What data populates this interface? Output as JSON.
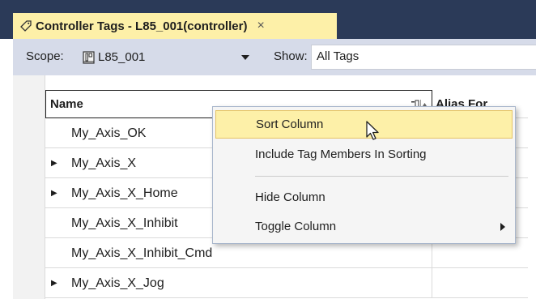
{
  "tab": {
    "title": "Controller Tags - L85_001(controller)",
    "icon": "tag-icon",
    "close_glyph": "×"
  },
  "toolbar": {
    "scope_label": "Scope:",
    "scope_value": "L85_001",
    "show_label": "Show:",
    "show_value": "All Tags"
  },
  "grid": {
    "columns": [
      "Name",
      "Alias For"
    ],
    "rows": [
      {
        "name": "My_Axis_OK",
        "expandable": false
      },
      {
        "name": "My_Axis_X",
        "expandable": true
      },
      {
        "name": "My_Axis_X_Home",
        "expandable": true
      },
      {
        "name": "My_Axis_X_Inhibit",
        "expandable": false
      },
      {
        "name": "My_Axis_X_Inhibit_Cmd",
        "expandable": false
      },
      {
        "name": "My_Axis_X_Jog",
        "expandable": true
      }
    ]
  },
  "context_menu": {
    "items": [
      {
        "label": "Sort Column",
        "highlighted": true
      },
      {
        "label": "Include Tag Members In Sorting"
      },
      {
        "label": "Hide Column"
      },
      {
        "label": "Toggle Column",
        "has_submenu": true
      }
    ]
  },
  "colors": {
    "tab_active": "#fdf0a8",
    "tabstrip_bg": "#2b3a58",
    "toolbar_bg": "#d6dbe9",
    "menu_highlight": "#fdf0a8"
  }
}
